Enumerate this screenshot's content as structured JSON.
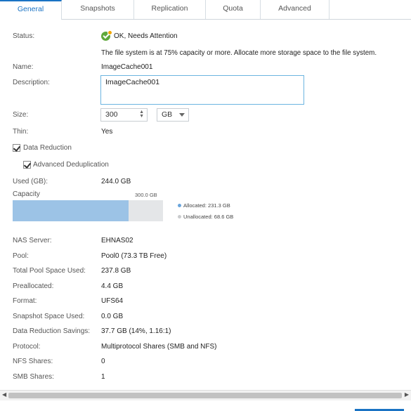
{
  "tabs": [
    "General",
    "Snapshots",
    "Replication",
    "Quota",
    "Advanced"
  ],
  "status": {
    "label": "Status:",
    "value": "OK, Needs Attention",
    "message": "The file system is at 75% capacity or more. Allocate more storage space to the file system."
  },
  "name": {
    "label": "Name:",
    "value": "ImageCache001"
  },
  "description": {
    "label": "Description:",
    "value": "ImageCache001"
  },
  "size": {
    "label": "Size:",
    "value": "300",
    "unit": "GB"
  },
  "thin": {
    "label": "Thin:",
    "value": "Yes"
  },
  "data_reduction": {
    "label": "Data Reduction",
    "checked": true
  },
  "advanced_dedup": {
    "label": "Advanced Deduplication",
    "checked": true
  },
  "used": {
    "label": "Used (GB):",
    "value": "244.0 GB"
  },
  "capacity": {
    "label": "Capacity",
    "total_label": "300.0 GB",
    "allocated_fraction": 0.771,
    "allocated": "Allocated: 231.3 GB",
    "unallocated": "Unallocated: 68.6 GB",
    "allocated_color": "#6aa5dc",
    "unallocated_color": "#c9cbcd"
  },
  "details": [
    {
      "label": "NAS Server:",
      "value": "EHNAS02"
    },
    {
      "label": "Pool:",
      "value": "Pool0 (73.3 TB Free)"
    },
    {
      "label": "Total Pool Space Used:",
      "value": "237.8 GB"
    },
    {
      "label": "Preallocated:",
      "value": "4.4 GB"
    },
    {
      "label": "Format:",
      "value": "UFS64"
    },
    {
      "label": "Snapshot Space Used:",
      "value": "0.0 GB"
    },
    {
      "label": "Data Reduction Savings:",
      "value": "37.7 GB (14%, 1.16:1)"
    },
    {
      "label": "Protocol:",
      "value": "Multiprotocol Shares (SMB and NFS)"
    },
    {
      "label": "NFS Shares:",
      "value": "0"
    },
    {
      "label": "SMB Shares:",
      "value": "1"
    }
  ]
}
